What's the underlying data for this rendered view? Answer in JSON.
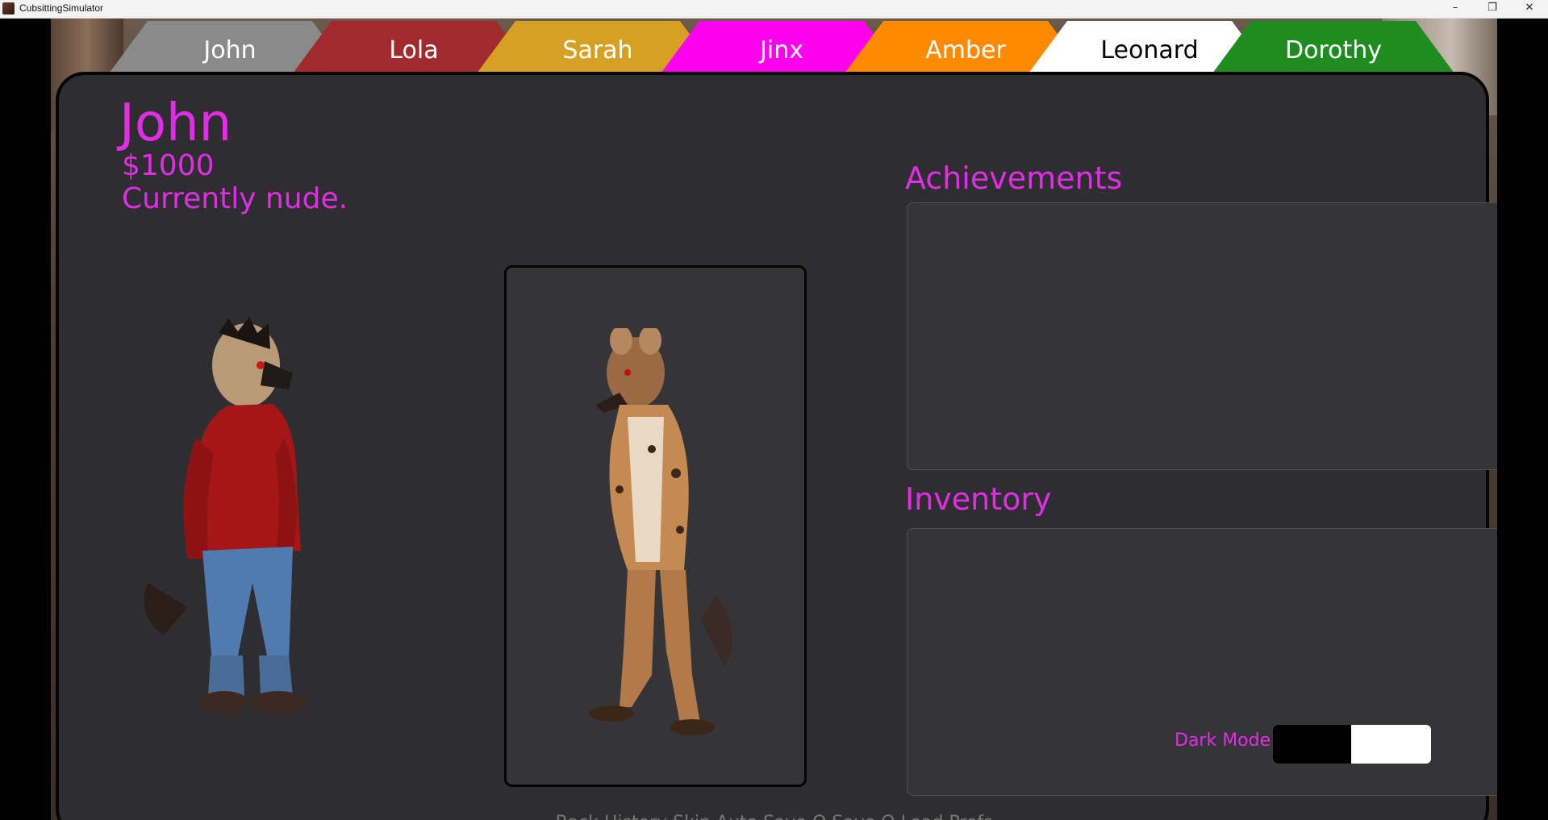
{
  "window": {
    "title": "CubsittingSimulator",
    "minimize_glyph": "–",
    "maximize_glyph": "❐",
    "close_glyph": "✕"
  },
  "tabs": [
    {
      "label": "John",
      "color": "#8a8a8a",
      "text_color": "#ffffff",
      "active": true
    },
    {
      "label": "Lola",
      "color": "#a02a2d",
      "text_color": "#ffffff"
    },
    {
      "label": "Sarah",
      "color": "#d6a024",
      "text_color": "#ffffff"
    },
    {
      "label": "Jinx",
      "color": "#ff00ee",
      "text_color": "#ffffff"
    },
    {
      "label": "Amber",
      "color": "#ff8a00",
      "text_color": "#ffffff"
    },
    {
      "label": "Leonard",
      "color": "#ffffff",
      "text_color": "#000000"
    },
    {
      "label": "Dorothy",
      "color": "#1f8c1f",
      "text_color": "#ffffff"
    }
  ],
  "profile": {
    "name": "John",
    "money": "$1000",
    "status": "Currently nude."
  },
  "sections": {
    "achievements": "Achievements",
    "inventory": "Inventory"
  },
  "settings": {
    "dark_mode_label": "Dark Mode",
    "dark_mode_on": true
  },
  "bottom_menu": "Back    History    Skip    Auto    Save    Q.Save    Q.Load    Prefs",
  "colors": {
    "accent": "#e12ee6",
    "panel": "#2e2e30"
  }
}
